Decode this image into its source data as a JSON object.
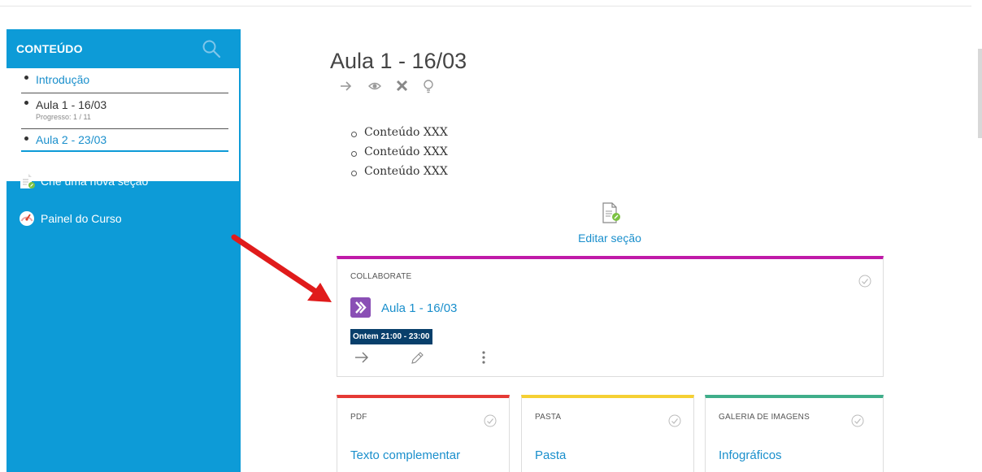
{
  "sidebar": {
    "title": "CONTEÚDO",
    "items": [
      {
        "label": "Introdução"
      },
      {
        "label": "Aula 1 - 16/03",
        "progress": "Progresso: 1 / 11"
      },
      {
        "label": "Aula 2 - 23/03"
      }
    ],
    "actions": [
      {
        "label": "Crie uma nova seção",
        "icon": "document-edit-icon"
      },
      {
        "label": "Painel do Curso",
        "icon": "dashboard-icon"
      }
    ]
  },
  "main": {
    "title": "Aula 1 - 16/03",
    "title_icons": [
      "arrow-right-icon",
      "eye-icon",
      "close-icon",
      "lightbulb-icon"
    ],
    "content_items": [
      "Conteúdo XXX",
      "Conteúdo XXX",
      "Conteúdo XXX"
    ],
    "edit_section_label": "Editar seção",
    "activity": {
      "type": "COLLABORATE",
      "title": "Aula 1 - 16/03",
      "time": "Ontem 21:00 - 23:00",
      "accent": "#c01aa8"
    },
    "resources": [
      {
        "type": "PDF",
        "title": "Texto complementar",
        "accent": "#e53935"
      },
      {
        "type": "PASTA",
        "title": "Pasta",
        "accent": "#f5d033"
      },
      {
        "type": "GALERIA DE IMAGENS",
        "title": "Infográficos",
        "accent": "#3fae8a"
      }
    ]
  },
  "colors": {
    "sidebar_bg": "#0d9bd7",
    "link": "#1a8fcc",
    "badge_bg": "#083f6b",
    "annotation_arrow": "#e01b1b"
  }
}
